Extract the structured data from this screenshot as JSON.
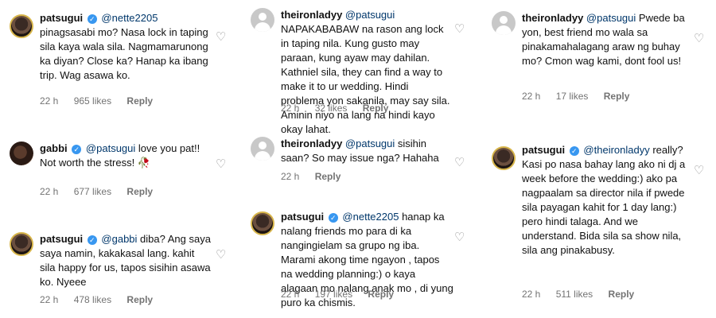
{
  "comments": [
    {
      "username": "patsugui",
      "mention": "@nette2205",
      "text": " pinagsasabi mo? Nasa lock in taping sila kaya wala sila. Nagmamarunong ka diyan? Close ka? Hanap ka ibang trip. Wag asawa ko.",
      "time": "22 h",
      "likes": "965 likes",
      "reply": "Reply"
    },
    {
      "username": "gabbi",
      "mention": "@patsugui",
      "text": " love you pat!! Not worth the stress!",
      "emoji": "🥀",
      "time": "22 h",
      "likes": "677 likes",
      "reply": "Reply"
    },
    {
      "username": "patsugui",
      "mention": "@gabbi",
      "text": " diba? Ang saya saya namin, kakakasal lang. kahit sila happy for us, tapos sisihin asawa ko. Nyeee",
      "time": "22 h",
      "likes": "478 likes",
      "reply": "Reply"
    },
    {
      "username": "theironladyy",
      "mention": "@patsugui",
      "text": " NAPAKABABAW na rason ang lock in taping nila. Kung gusto may paraan, kung ayaw may dahilan. Kathniel sila, they can find a way to make it to ur wedding. Hindi problema yon sakanila, may say sila. Aminin niyo na lang na hindi kayo okay lahat.",
      "time": "22 h",
      "likes": "32 likes",
      "reply": "Reply"
    },
    {
      "username": "theironladyy",
      "mention": "@patsugui",
      "text": " sisihin saan? So may issue nga? Hahaha",
      "time": "22 h",
      "likes": "",
      "reply": "Reply"
    },
    {
      "username": "patsugui",
      "mention": "@nette2205",
      "text": " hanap ka nalang friends mo para di ka nangingielam sa grupo ng iba. Marami akong time ngayon , tapos na wedding planning:) o kaya alagaan mo nalang anak mo , di yung puro ka chismis.",
      "time": "22 h",
      "likes": "197 likes",
      "reply": "Reply"
    },
    {
      "username": "theironladyy",
      "mention": "@patsugui",
      "text": " Pwede ba yon, best friend mo wala sa pinakamahalagang araw ng buhay mo? Cmon wag kami, dont fool us!",
      "time": "22 h",
      "likes": "17 likes",
      "reply": "Reply"
    },
    {
      "username": "patsugui",
      "mention": "@theironladyy",
      "text": " really? Kasi po nasa bahay lang ako ni dj a week before the wedding:) ako pa nagpaalam sa director nila if pwede sila payagan kahit for 1 day lang:) pero hindi talaga. And we understand. Bida sila sa show nila, sila ang pinakabusy.",
      "time": "22 h",
      "likes": "511 likes",
      "reply": "Reply"
    }
  ]
}
